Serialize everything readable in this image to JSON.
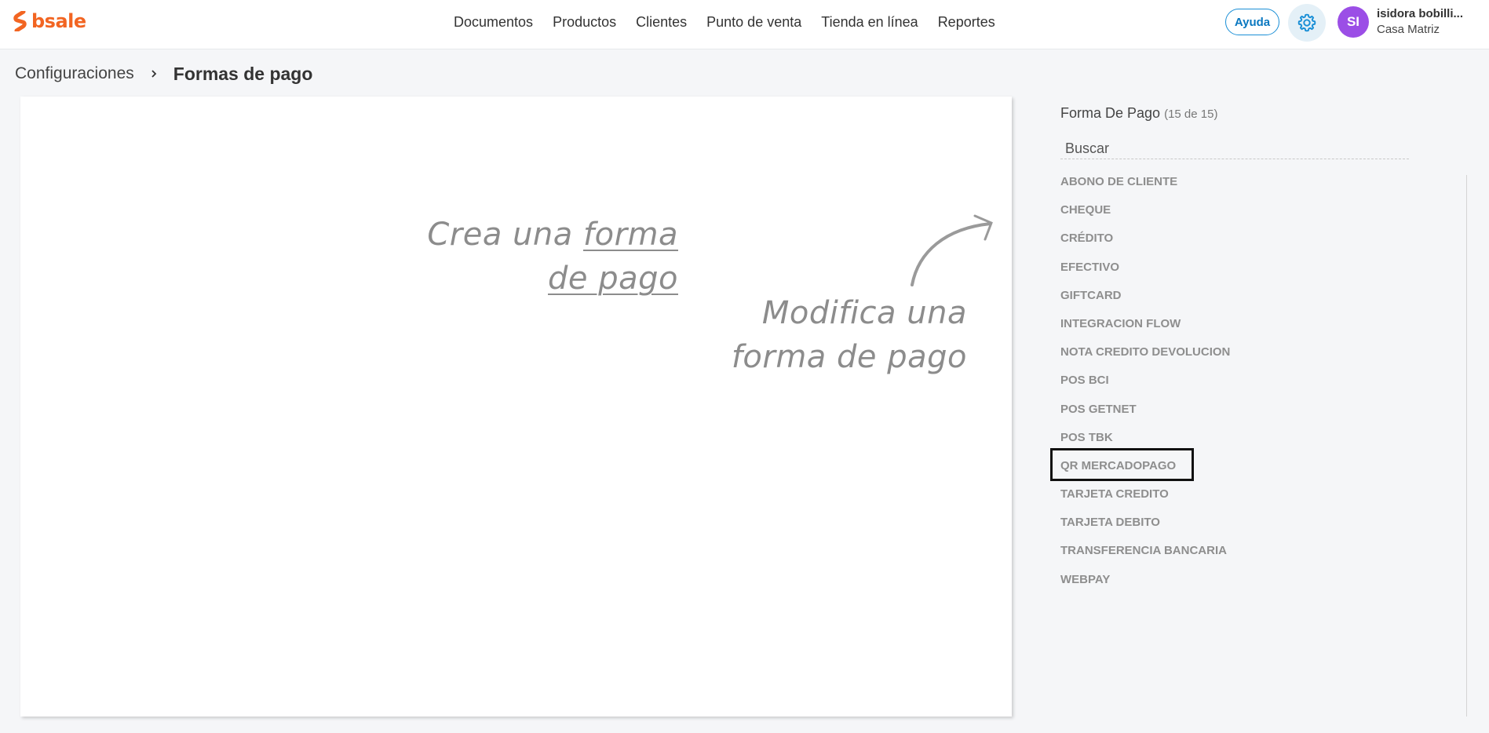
{
  "brand": {
    "logo_text": "bsale",
    "color": "#f26522"
  },
  "nav": {
    "items": [
      "Documentos",
      "Productos",
      "Clientes",
      "Punto de venta",
      "Tienda en línea",
      "Reportes"
    ]
  },
  "header": {
    "help_label": "Ayuda",
    "settings_icon": "gear-icon",
    "avatar_initials": "SI",
    "user_name": "isidora bobilli...",
    "branch": "Casa Matriz"
  },
  "breadcrumb": {
    "parent": "Configuraciones",
    "separator_icon": "chevron-right-icon",
    "current": "Formas de pago"
  },
  "canvas": {
    "create_prefix": "Crea una",
    "create_link_line1": "forma",
    "create_link_line2": "de pago",
    "modify_line1": "Modifica una",
    "modify_line2": "forma de pago",
    "arrow_icon": "curved-arrow-icon"
  },
  "panel": {
    "title": "Forma De Pago",
    "count": "(15 de 15)",
    "search_placeholder": "Buscar",
    "items": [
      "ABONO DE CLIENTE",
      "CHEQUE",
      "CRÉDITO",
      "EFECTIVO",
      "GIFTCARD",
      "INTEGRACION FLOW",
      "NOTA CREDITO DEVOLUCION",
      "POS BCI",
      "POS GETNET",
      "POS TBK",
      "QR MERCADOPAGO",
      "TARJETA CREDITO",
      "TARJETA DEBITO",
      "TRANSFERENCIA BANCARIA",
      "WEBPAY"
    ],
    "highlighted_item": "QR MERCADOPAGO"
  },
  "colors": {
    "accent_blue": "#1a8fd6",
    "avatar_purple": "#9b4ee6",
    "list_text": "#8e8e8e"
  }
}
